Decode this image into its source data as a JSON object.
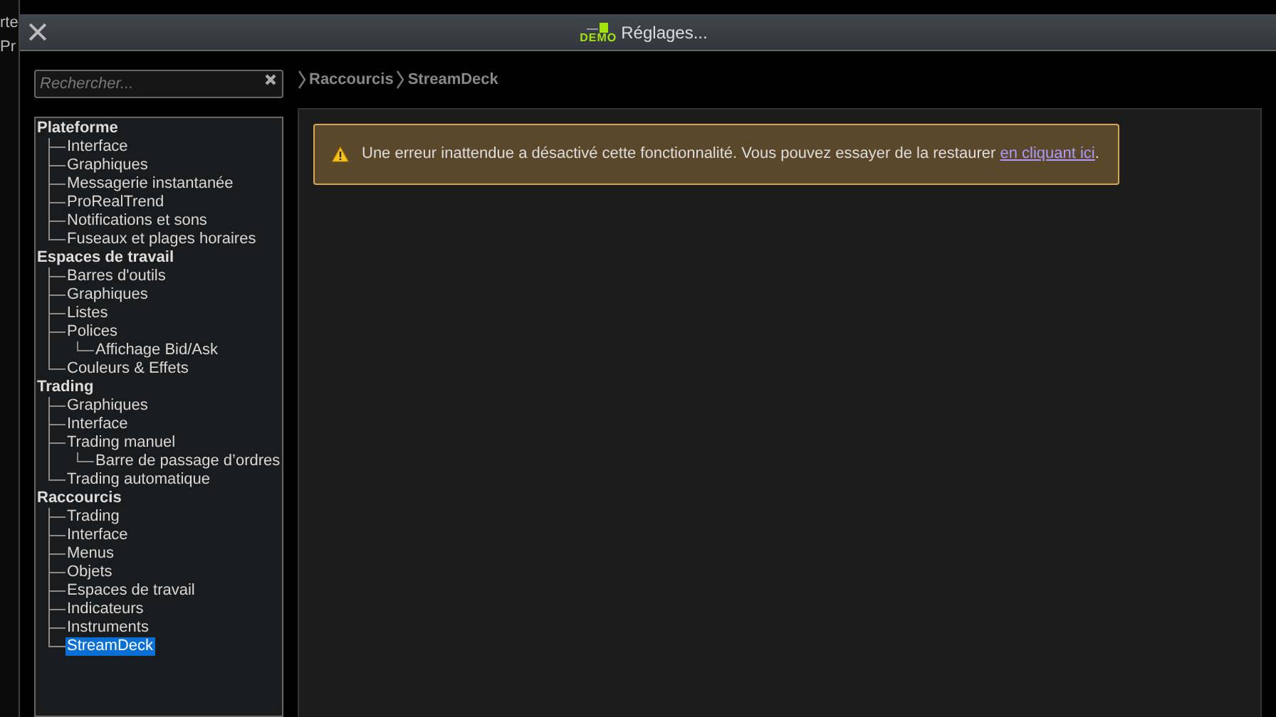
{
  "background_app": {
    "fragments": [
      "rte",
      "Pr"
    ]
  },
  "window": {
    "title": "Réglages...",
    "logo_text": "DEMO"
  },
  "search": {
    "placeholder": "Rechercher..."
  },
  "breadcrumb": [
    "Raccourcis",
    "StreamDeck"
  ],
  "tree": [
    {
      "label": "Plateforme",
      "children": [
        {
          "label": "Interface",
          "selected": false
        },
        {
          "label": "Graphiques",
          "selected": false
        },
        {
          "label": "Messagerie instantanée",
          "selected": false
        },
        {
          "label": "ProRealTrend",
          "selected": false
        },
        {
          "label": "Notifications et sons",
          "selected": false
        },
        {
          "label": "Fuseaux et plages horaires",
          "selected": false
        }
      ]
    },
    {
      "label": "Espaces de travail",
      "children": [
        {
          "label": "Barres d'outils",
          "selected": false
        },
        {
          "label": "Graphiques",
          "selected": false
        },
        {
          "label": "Listes",
          "selected": false
        },
        {
          "label": "Polices",
          "selected": false,
          "children": [
            {
              "label": "Affichage Bid/Ask",
              "selected": false
            }
          ]
        },
        {
          "label": "Couleurs & Effets",
          "selected": false
        }
      ]
    },
    {
      "label": "Trading",
      "children": [
        {
          "label": "Graphiques",
          "selected": false
        },
        {
          "label": "Interface",
          "selected": false
        },
        {
          "label": "Trading manuel",
          "selected": false,
          "children": [
            {
              "label": "Barre de passage d’ordres",
              "selected": false
            }
          ]
        },
        {
          "label": "Trading automatique",
          "selected": false
        }
      ]
    },
    {
      "label": "Raccourcis",
      "children": [
        {
          "label": "Trading",
          "selected": false
        },
        {
          "label": "Interface",
          "selected": false
        },
        {
          "label": "Menus",
          "selected": false
        },
        {
          "label": "Objets",
          "selected": false
        },
        {
          "label": "Espaces de travail",
          "selected": false
        },
        {
          "label": "Indicateurs",
          "selected": false
        },
        {
          "label": "Instruments",
          "selected": false
        },
        {
          "label": "StreamDeck",
          "selected": true
        }
      ]
    }
  ],
  "alert": {
    "message": "Une erreur inattendue a désactivé cette fonctionnalité. Vous pouvez essayer de la restaurer ",
    "link": "en cliquant ici",
    "end": "."
  }
}
